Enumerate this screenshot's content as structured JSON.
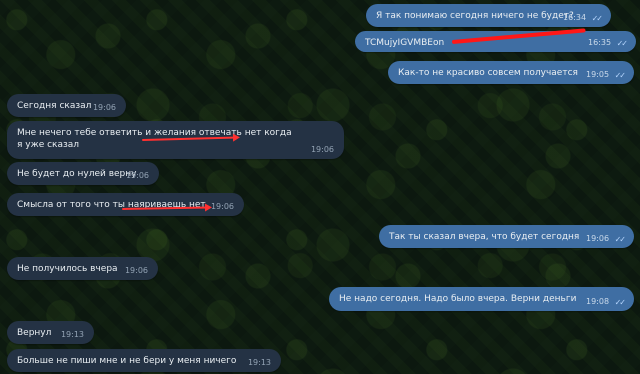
{
  "chat": {
    "messages": [
      {
        "text": "Я так понимаю сегодня ничего не будет?",
        "time": "16:34"
      },
      {
        "text": "TCMujyIGVMBEon",
        "time": "16:35"
      },
      {
        "text": "Как-то не красиво совсем получается",
        "time": "19:05"
      },
      {
        "text": "Сегодня сказал",
        "time": "19:06"
      },
      {
        "text": "Мне нечего тебе ответить и желания отвечать нет когда я уже сказал",
        "time": "19:06"
      },
      {
        "text": "Не будет до нулей верну",
        "time": "19:06"
      },
      {
        "text": "Смысла от того что ты наяриваешь нет",
        "time": "19:06"
      },
      {
        "text": "Так ты сказал вчера, что будет сегодня",
        "time": "19:06"
      },
      {
        "text": "Не получилось вчера",
        "time": "19:06"
      },
      {
        "text": "Не надо сегодня. Надо было вчера. Верни деньги",
        "time": "19:08"
      },
      {
        "text": "Вернул",
        "time": "19:13"
      },
      {
        "text": "Больше не пиши мне и не бери у меня ничего",
        "time": "19:13"
      }
    ]
  },
  "icons": {
    "read_receipt": "✓✓"
  },
  "colors": {
    "incoming_bubble": "#243244",
    "outgoing_bubble": "#3f6ea3",
    "annotation_red": "#ff3030",
    "chat_background": "#0d1a10"
  }
}
